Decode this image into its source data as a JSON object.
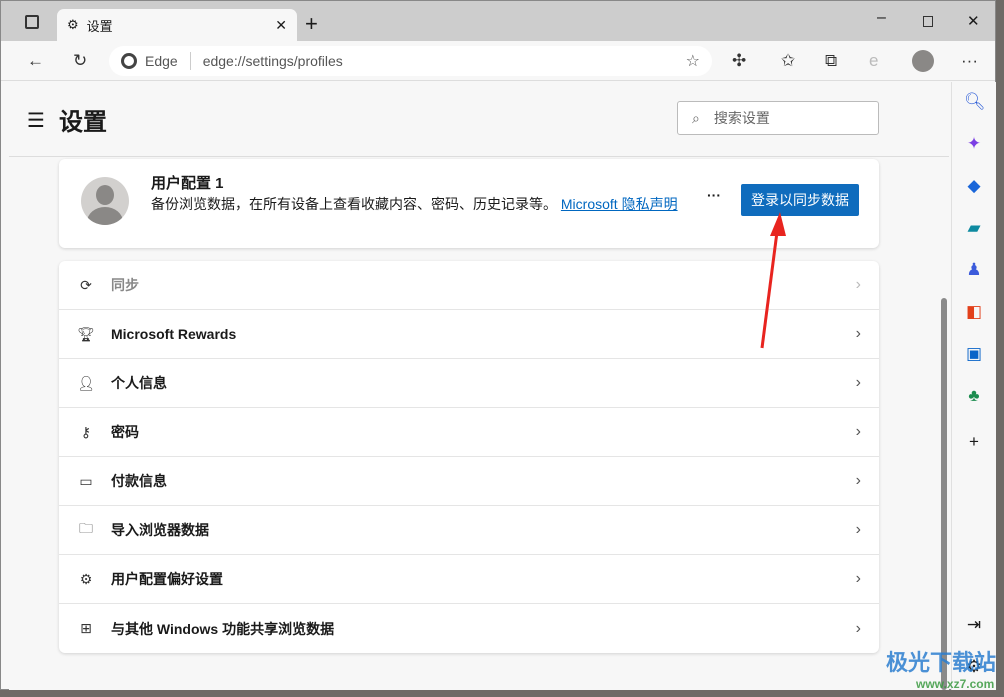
{
  "tab": {
    "title": "设置"
  },
  "address": {
    "site_label": "Edge",
    "url": "edge://settings/profiles"
  },
  "header": {
    "title": "设置",
    "search_placeholder": "搜索设置"
  },
  "profile": {
    "name": "用户配置 1",
    "description": "备份浏览数据，在所有设备上查看收藏内容、密码、历史记录等。",
    "privacy_link": "Microsoft 隐私声明",
    "more": "···",
    "sign_in": "登录以同步数据"
  },
  "items": [
    {
      "label": "同步",
      "icon": "sync-icon",
      "disabled": true
    },
    {
      "label": "Microsoft Rewards",
      "icon": "trophy-icon"
    },
    {
      "label": "个人信息",
      "icon": "person-info-icon"
    },
    {
      "label": "密码",
      "icon": "key-icon"
    },
    {
      "label": "付款信息",
      "icon": "credit-card-icon"
    },
    {
      "label": "导入浏览器数据",
      "icon": "import-folder-icon"
    },
    {
      "label": "用户配置偏好设置",
      "icon": "profile-settings-icon"
    },
    {
      "label": "与其他 Windows 功能共享浏览数据",
      "icon": "windows-icon"
    }
  ],
  "watermark": {
    "text": "极光下载站",
    "url": "www.xz7.com"
  },
  "colors": {
    "accent": "#0f6cbd",
    "link": "#0067c0",
    "arrow": "#e8241f"
  }
}
